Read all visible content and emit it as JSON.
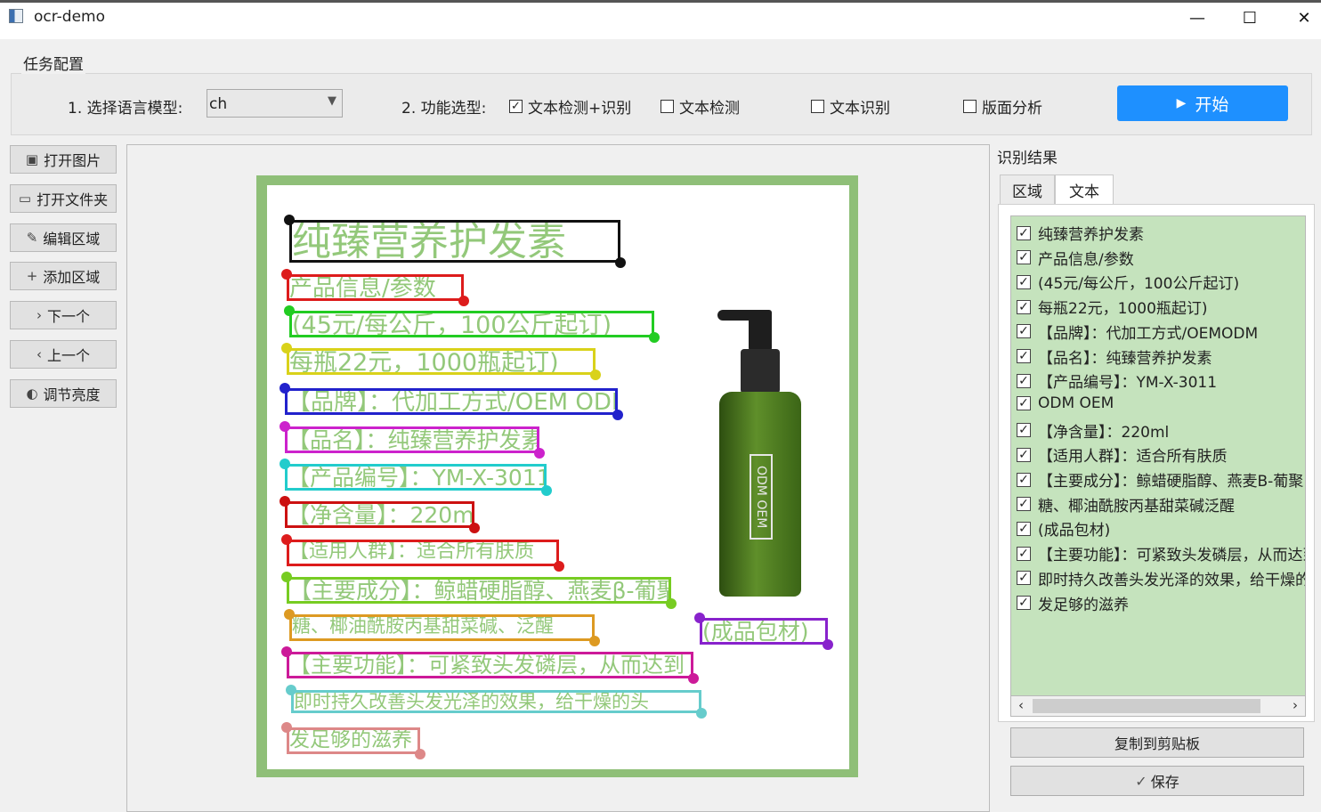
{
  "window": {
    "title": "ocr-demo",
    "minimize": "—",
    "maximize": "☐",
    "close": "✕"
  },
  "config": {
    "group_title": "任务配置",
    "model_label": "1. 选择语言模型:",
    "model_value": "ch",
    "function_label": "2. 功能选型:",
    "options": [
      {
        "label": "文本检测+识别",
        "checked": true
      },
      {
        "label": "文本检测",
        "checked": false
      },
      {
        "label": "文本识别",
        "checked": false
      },
      {
        "label": "版面分析",
        "checked": false
      }
    ],
    "start_label": "开始",
    "start_color": "#1e90ff"
  },
  "sidebar": {
    "buttons": [
      {
        "label": "打开图片",
        "icon": "image-icon"
      },
      {
        "label": "打开文件夹",
        "icon": "folder-icon"
      },
      {
        "label": "编辑区域",
        "icon": "pencil-icon"
      },
      {
        "label": "添加区域",
        "icon": "plus-icon"
      },
      {
        "label": "下一个",
        "icon": "chevron-right-icon"
      },
      {
        "label": "上一个",
        "icon": "chevron-left-icon"
      },
      {
        "label": "调节亮度",
        "icon": "brightness-icon"
      }
    ]
  },
  "image": {
    "detections": [
      {
        "text": "纯臻营养护发素",
        "color": "#111111"
      },
      {
        "text": "产品信息/参数",
        "color": "#dd1c1c"
      },
      {
        "text": "(45元/每公斤，100公斤起订)",
        "color": "#22cc22"
      },
      {
        "text": "每瓶22元，1000瓶起订)",
        "color": "#d9d21a"
      },
      {
        "text": "【品牌】：代加工方式/OEM ODM",
        "color": "#2222cc"
      },
      {
        "text": "【品名】：纯臻营养护发素",
        "color": "#cc22cc"
      },
      {
        "text": "【产品编号】：YM-X-3011",
        "color": "#22cccc"
      },
      {
        "text": "【净含量】：220ml",
        "color": "#cc1111"
      },
      {
        "text": "【适用人群】：适合所有肤质",
        "color": "#dd1c1c"
      },
      {
        "text": "【主要成分】：鲸蜡硬脂醇、燕麦β-葡聚",
        "color": "#77cc22"
      },
      {
        "text": "糖、椰油酰胺丙基甜菜碱、泛醒",
        "color": "#dd9a22"
      },
      {
        "text": "【主要功能】：可紧致头发磷层，从而达到",
        "color": "#cc1a99"
      },
      {
        "text": "即时持久改善头发光泽的效果，给干燥的头",
        "color": "#66cccc"
      },
      {
        "text": "发足够的滋养",
        "color": "#dd8888"
      },
      {
        "text": "(成品包材)",
        "color": "#8822cc"
      }
    ],
    "bottle_label": "ODM OEM"
  },
  "results": {
    "title": "识别结果",
    "tabs": [
      "区域",
      "文本"
    ],
    "active_tab": "文本",
    "items": [
      "纯臻营养护发素",
      "产品信息/参数",
      "(45元/每公斤，100公斤起订)",
      "每瓶22元，1000瓶起订)",
      "【品牌】：代加工方式/OEMODM",
      "【品名】：纯臻营养护发素",
      "【产品编号】：YM-X-3011",
      "ODM OEM",
      "【净含量】：220ml",
      "【适用人群】：适合所有肤质",
      "【主要成分】：鲸蜡硬脂醇、燕麦B-葡聚",
      "糖、椰油酰胺丙基甜菜碱泛醒",
      "(成品包材)",
      "【主要功能】：可紧致头发磷层，从而达到",
      "即时持久改善头发光泽的效果，给干燥的头",
      "发足够的滋养"
    ],
    "copy_label": "复制到剪贴板",
    "save_label": "保存",
    "list_bg": "#c5e3bd"
  }
}
